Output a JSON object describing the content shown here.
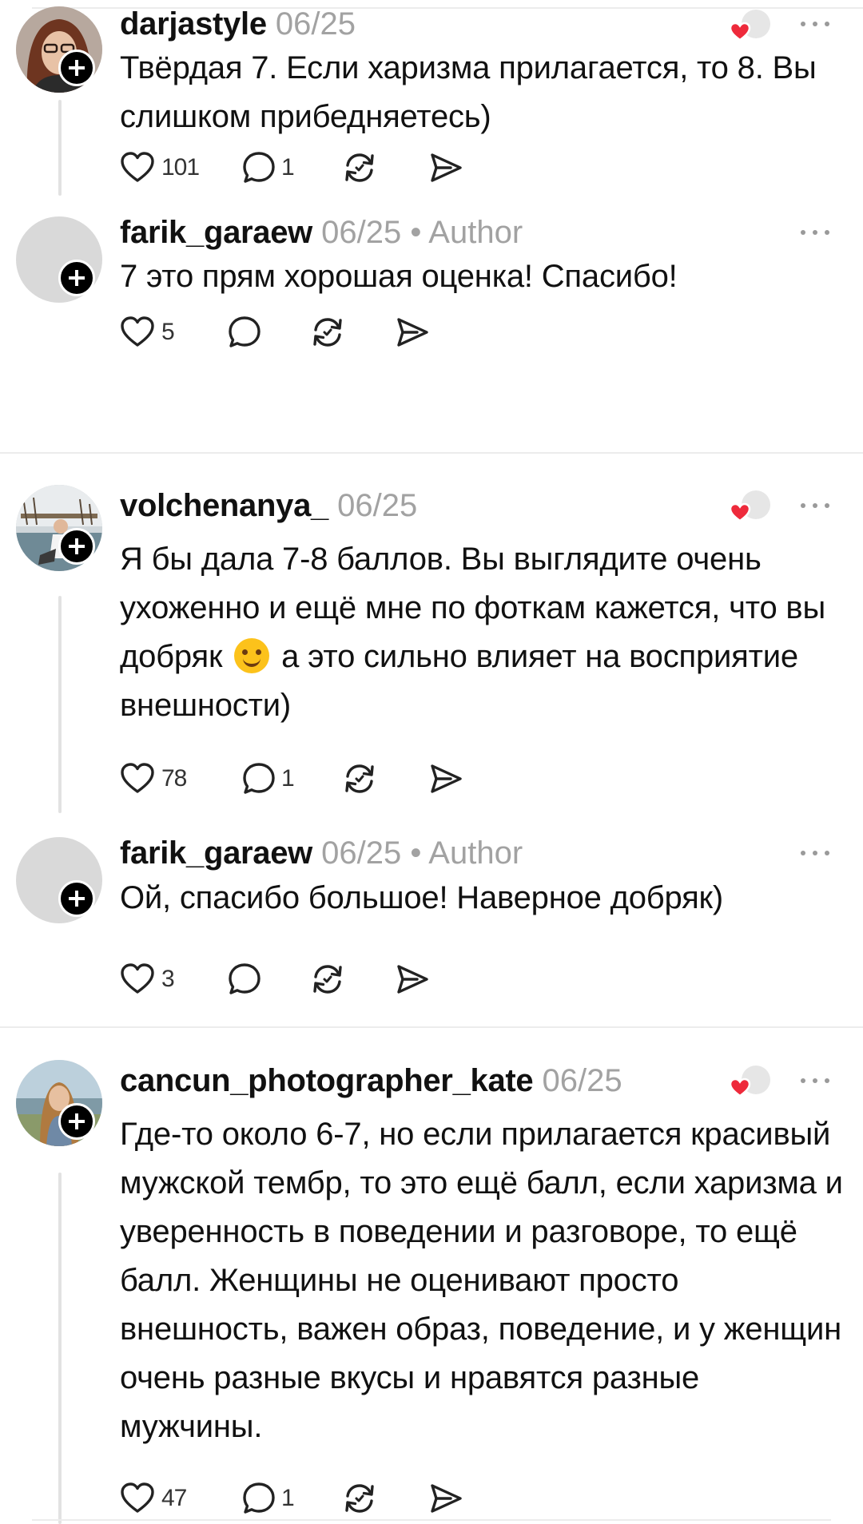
{
  "comments": [
    {
      "username": "darjastyle",
      "date": "06/25",
      "text": "Твёрдая 7. Если харизма прилагается, то 8. Вы слишком прибедняетесь)",
      "likes": "101",
      "replies": "1",
      "avatar": "photo-avatar-woman-glasses"
    },
    {
      "username": "farik_garaew",
      "date": "06/25",
      "separator": "•",
      "author_tag": "Author",
      "text": "7 это прям хорошая оценка! Спасибо!",
      "likes": "5",
      "avatar": "placeholder-avatar"
    },
    {
      "username": "volchenanya_",
      "date": "06/25",
      "text_before_emoji": "Я бы дала 7-8 баллов. Вы  выглядите очень ухоженно и ещё мне по фоткам кажется, что вы добряк",
      "emoji": "smiling-face-emoji",
      "text_after_emoji": "а это сильно влияет на восприятие внешности)",
      "likes": "78",
      "replies": "1",
      "avatar": "photo-avatar-woman-harbor"
    },
    {
      "username": "farik_garaew",
      "date": "06/25",
      "separator": "•",
      "author_tag": "Author",
      "text": "Ой, спасибо большое! Наверное добряк)",
      "likes": "3",
      "avatar": "placeholder-avatar"
    },
    {
      "username": "cancun_photographer_kate",
      "date": "06/25",
      "text": "Где-то около 6-7, но если прилагается красивый мужской тембр, то это ещё балл, если харизма и уверенность в поведении и разговоре, то ещё балл. Женщины не оценивают просто внешность, важен образ, поведение, и у женщин очень разные вкусы и нравятся разные мужчины.",
      "likes": "47",
      "replies": "1",
      "avatar": "photo-avatar-woman-lake"
    }
  ],
  "icons": {
    "like": "heart-outline-icon",
    "reply": "speech-bubble-icon",
    "repost": "repost-arrows-icon",
    "share": "send-arrow-icon",
    "more": "more-horizontal-icon",
    "liked_by_author": "author-liked-heart-icon"
  },
  "colors": {
    "liked_heart": "#ee2a3b",
    "text": "#111111",
    "secondary": "#a2a2a2",
    "follow_badge": "#000000"
  }
}
